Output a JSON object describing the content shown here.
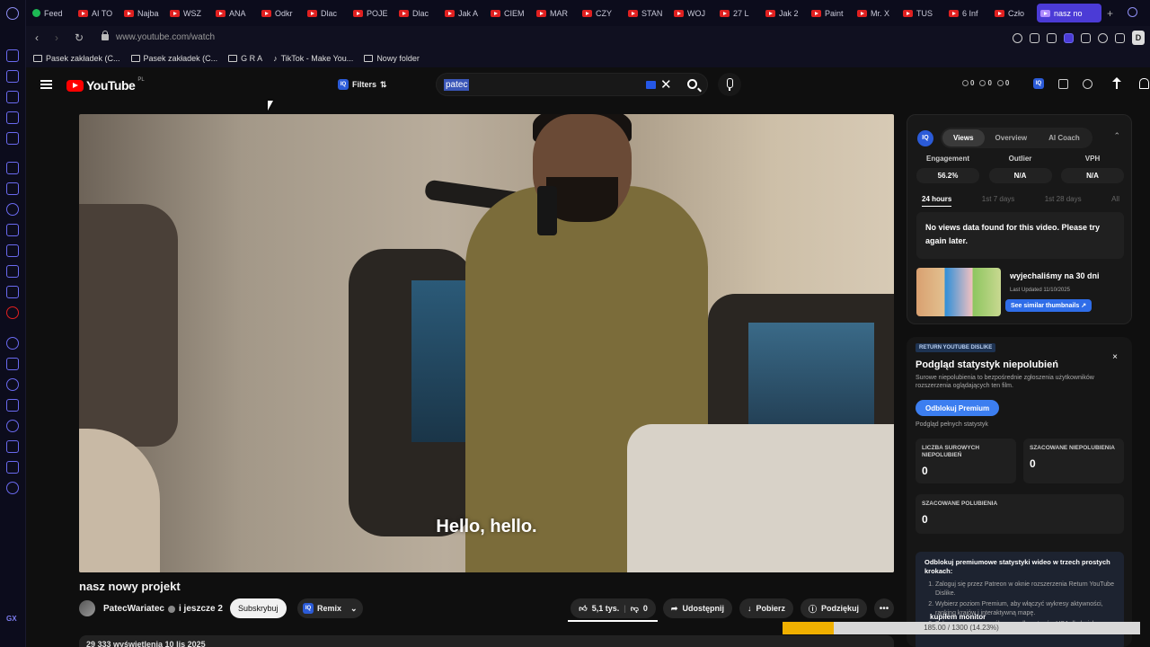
{
  "browser": {
    "tabs": [
      {
        "label": "Feed",
        "favicon": "green-circle-icon"
      },
      {
        "label": "AI TO",
        "favicon": "youtube-icon"
      },
      {
        "label": "Najba",
        "favicon": "youtube-icon"
      },
      {
        "label": "WSZ",
        "favicon": "youtube-icon"
      },
      {
        "label": "ANA",
        "favicon": "youtube-icon"
      },
      {
        "label": "Odkr",
        "favicon": "youtube-icon"
      },
      {
        "label": "Dlac",
        "favicon": "youtube-icon"
      },
      {
        "label": "POJE",
        "favicon": "youtube-icon"
      },
      {
        "label": "Dlac",
        "favicon": "youtube-icon"
      },
      {
        "label": "Jak A",
        "favicon": "youtube-icon"
      },
      {
        "label": "CIEM",
        "favicon": "youtube-icon"
      },
      {
        "label": "MAR",
        "favicon": "youtube-icon"
      },
      {
        "label": "CZY",
        "favicon": "youtube-icon"
      },
      {
        "label": "STAN",
        "favicon": "youtube-icon"
      },
      {
        "label": "WOJ",
        "favicon": "youtube-icon"
      },
      {
        "label": "27 L",
        "favicon": "youtube-icon"
      },
      {
        "label": "Jak 2",
        "favicon": "youtube-icon"
      },
      {
        "label": "Paint",
        "favicon": "youtube-icon"
      },
      {
        "label": "Mr. X",
        "favicon": "youtube-icon"
      },
      {
        "label": "TUS",
        "favicon": "youtube-icon"
      },
      {
        "label": "6 Inf",
        "favicon": "youtube-icon"
      },
      {
        "label": "Czło",
        "favicon": "youtube-icon"
      },
      {
        "label": "nasz no",
        "favicon": "youtube-icon",
        "active": true
      }
    ],
    "url": "www.youtube.com/watch",
    "profile_initial": "D",
    "bookmarks": [
      {
        "label": "Pasek zakładek (C...",
        "icon": "folder-icon"
      },
      {
        "label": "Pasek zakładek (C...",
        "icon": "folder-icon"
      },
      {
        "label": "G R A",
        "icon": "folder-icon"
      },
      {
        "label": "TikTok - Make You...",
        "icon": "tiktok-icon"
      },
      {
        "label": "Nowy folder",
        "icon": "folder-icon"
      }
    ],
    "sidebar_bottom_label": "GX",
    "accent_color": "#4b3bd6"
  },
  "youtube": {
    "logo_text": "YouTube",
    "logo_region": "PL",
    "filters_label": "Filters",
    "search_value": "patec",
    "counters": [
      "0",
      "0",
      "0"
    ],
    "video": {
      "subtitle": "Hello, hello.",
      "title": "nasz nowy projekt",
      "channel": "PatecWariatec",
      "channel_suffix": "i jeszcze 2",
      "subscribe_label": "Subskrybuj",
      "remix_label": "Remix",
      "likes": "5,1 tys.",
      "dislikes": "0",
      "share_label": "Udostępnij",
      "download_label": "Pobierz",
      "thanks_label": "Podziękuj",
      "more_label": "•••",
      "description_stats": "29 333 wyświetlenia  10 lis 2025"
    }
  },
  "vidiq_panel": {
    "badge": "IQ",
    "tabs": [
      "Views",
      "Overview",
      "AI Coach"
    ],
    "active_tab": "Views",
    "stats": [
      {
        "label": "Engagement",
        "value": "56.2%"
      },
      {
        "label": "Outlier",
        "value": "N/A"
      },
      {
        "label": "VPH",
        "value": "N/A"
      }
    ],
    "ranges": [
      "24 hours",
      "1st 7 days",
      "1st 28 days",
      "All"
    ],
    "active_range": "24 hours",
    "no_data_message": "No views data found for this video. Please try again later.",
    "related": {
      "title": "wyjechaliśmy na 30 dni",
      "updated": "Last Updated 11/10/2025",
      "button": "See similar thumbnails ↗"
    }
  },
  "dislike_panel": {
    "tag": "RETURN YOUTUBE DISLIKE",
    "close": "×",
    "title": "Podgląd statystyk niepolubień",
    "description": "Surowe niepolubienia to bezpośrednie zgłoszenia użytkowników rozszerzenia oglądających ten film.",
    "unlock_button": "Odblokuj Premium",
    "preview_note": "Podgląd pełnych statystyk",
    "cards": [
      {
        "label": "LICZBA SUROWYCH NIEPOLUBIEŃ",
        "value": "0"
      },
      {
        "label": "SZACOWANE NIEPOLUBIENIA",
        "value": "0"
      },
      {
        "label": "SZACOWANE POLUBIENIA",
        "value": "0"
      }
    ],
    "promo_title": "Odblokuj premiumowe statystyki wideo w trzech prostych krokach:",
    "promo_steps": [
      "Zaloguj się przez Patreon w oknie rozszerzenia Return YouTube Dislike.",
      "Wybierz poziom Premium, aby włączyć wykresy aktywności, ranking krajów i interaktywną mapę.",
      "Zobacz mapę szczegółowy według stanów USA dla każdego filmu."
    ]
  },
  "download_overlay": {
    "title": "kupiłem monitor",
    "progress_text": "185.00 / 1300 (14.23%)",
    "progress_fraction": 0.1423,
    "fill_color": "#f0b000"
  }
}
